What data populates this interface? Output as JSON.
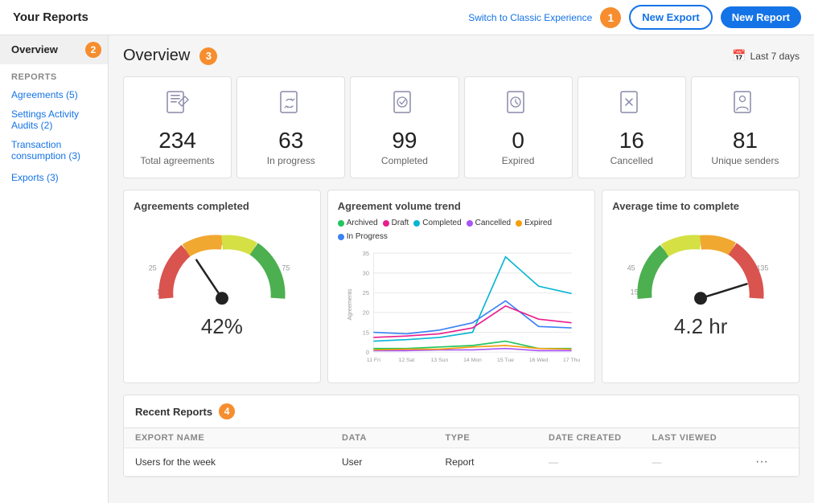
{
  "app": {
    "title": "Your Reports",
    "switch_link": "Switch to Classic Experience",
    "btn_export": "New Export",
    "btn_report": "New Report"
  },
  "sidebar": {
    "nav_items": [
      {
        "label": "Overview",
        "active": true
      }
    ],
    "section_label": "REPORTS",
    "links": [
      {
        "label": "Agreements (5)"
      },
      {
        "label": "Settings Activity Audits (2)"
      },
      {
        "label": "Transaction consumption (3)"
      }
    ],
    "exports_label": "Exports (3)"
  },
  "overview": {
    "title": "Overview",
    "date_filter": "Last 7 days",
    "stats": [
      {
        "value": "234",
        "label": "Total agreements",
        "icon": "📄"
      },
      {
        "value": "63",
        "label": "In progress",
        "icon": "🔄"
      },
      {
        "value": "99",
        "label": "Completed",
        "icon": "✅"
      },
      {
        "value": "0",
        "label": "Expired",
        "icon": "⏰"
      },
      {
        "value": "16",
        "label": "Cancelled",
        "icon": "❌"
      },
      {
        "value": "81",
        "label": "Unique senders",
        "icon": "👤"
      }
    ]
  },
  "charts": {
    "completed_title": "Agreements completed",
    "completed_pct": "42%",
    "completed_value": 42,
    "volume_title": "Agreement volume trend",
    "avg_time_title": "Average time to complete",
    "avg_time_value": "4.2 hr",
    "avg_time_num": 135,
    "legend": [
      {
        "label": "Archived",
        "color": "#22c55e"
      },
      {
        "label": "Draft",
        "color": "#e91e8c"
      },
      {
        "label": "Completed",
        "color": "#06b6d4"
      },
      {
        "label": "Cancelled",
        "color": "#a855f7"
      },
      {
        "label": "Expired",
        "color": "#f59e0b"
      },
      {
        "label": "In Progress",
        "color": "#3b82f6"
      }
    ],
    "xaxis": [
      "11 Fri",
      "12 Sat",
      "13 Sun",
      "14 Mon",
      "15 Tue",
      "16 Wed",
      "17 Thu"
    ]
  },
  "recent_reports": {
    "title": "Recent Reports",
    "columns": [
      "EXPORT NAME",
      "DATA",
      "TYPE",
      "DATE CREATED",
      "LAST VIEWED",
      ""
    ],
    "rows": [
      {
        "name": "Users for the week",
        "data": "User",
        "type": "Report",
        "date_created": "—",
        "last_viewed": "—"
      }
    ]
  },
  "badges": {
    "b1": "1",
    "b2": "2",
    "b3": "3",
    "b4": "4"
  }
}
